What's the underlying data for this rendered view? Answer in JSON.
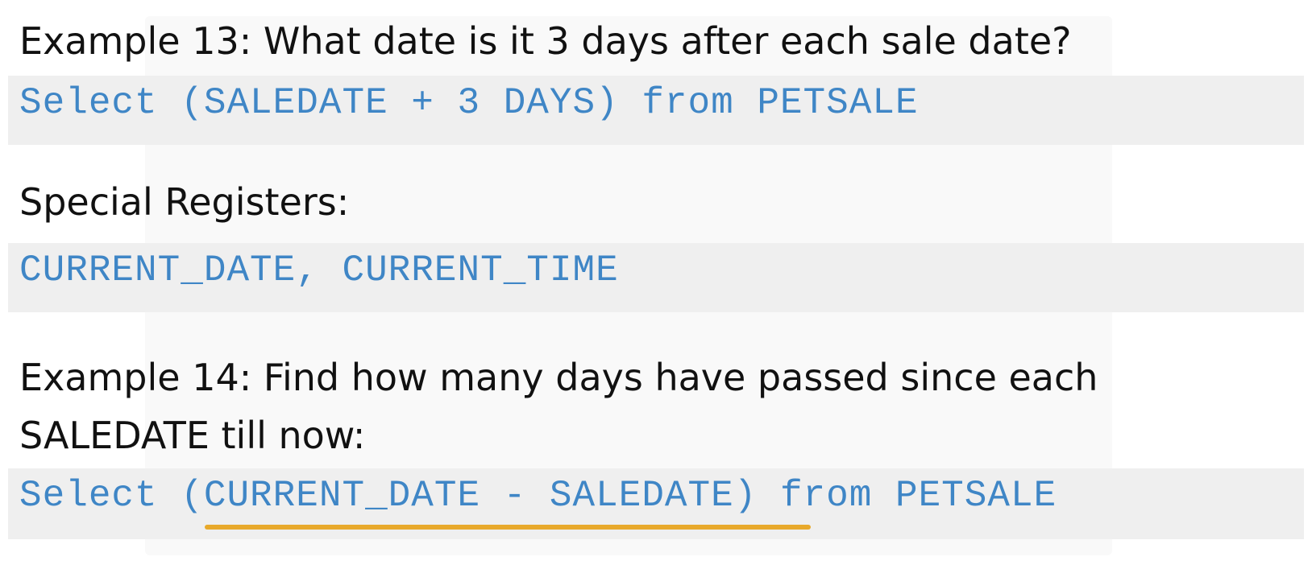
{
  "example13": {
    "question": "Example 13: What date is it 3 days after each sale date?",
    "code": "Select (SALEDATE + 3 DAYS) from PETSALE"
  },
  "special_registers": {
    "heading": "Special Registers:",
    "code": "CURRENT_DATE, CURRENT_TIME"
  },
  "example14": {
    "question_line1": "Example 14: Find how many days have passed since each",
    "question_line2": "SALEDATE till now:",
    "code": "Select (CURRENT_DATE - SALEDATE) from PETSALE",
    "highlighted_segment": "(CURRENT_DATE - SALEDATE)"
  },
  "colors": {
    "code_text": "#3f86c6",
    "code_background": "#efefef",
    "highlight_underline": "#e8a92b"
  }
}
